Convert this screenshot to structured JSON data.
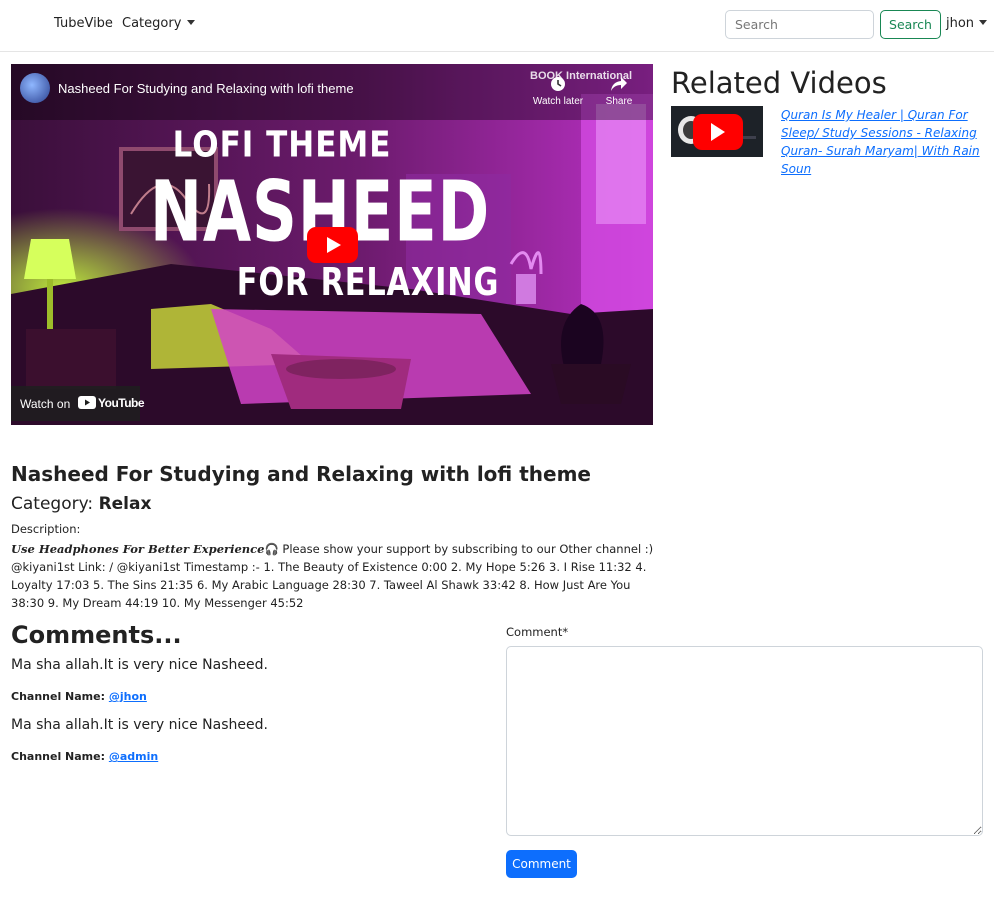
{
  "navbar": {
    "brand": "TubeVibe",
    "category_label": "Category",
    "search_placeholder": "Search",
    "search_button": "Search",
    "user": "jhon"
  },
  "video": {
    "embed_title": "Nasheed For Studying and Relaxing with lofi theme",
    "channel_watermark": "BOOK International",
    "watch_later": "Watch later",
    "share": "Share",
    "thumbnail_line1": "LOFI THEME",
    "thumbnail_line2": "NASHEED",
    "thumbnail_line3": "FOR RELAXING",
    "watch_on": "Watch on",
    "youtube": "YouTube",
    "title": "Nasheed For Studying and Relaxing with lofi theme",
    "category_prefix": "Category:",
    "category": "Relax",
    "description_label": "Description:",
    "description_emphasis": "Use Headphones For Better Experience",
    "description_body": "🎧 Please show your support by subscribing to our Other channel :) @kiyani1st Link: / @kiyani1st Timestamp :- 1. The Beauty of Existence 0:00 2. My Hope 5:26 3. I Rise 11:32 4. Loyalty 17:03 5. The Sins 21:35 6. My Arabic Language 28:30 7. Taweel Al Shawk 33:42 8. How Just Are You 38:30 9. My Dream 44:19 10. My Messenger 45:52"
  },
  "related": {
    "title": "Related Videos",
    "items": [
      {
        "title": "Quran Is My Healer | Quran For Sleep/ Study Sessions - Relaxing Quran- Surah Maryam| With Rain Soun"
      }
    ]
  },
  "comments": {
    "title": "Comments...",
    "channel_label": "Channel Name:",
    "items": [
      {
        "text": "Ma sha allah.It is very nice Nasheed.",
        "channel": "@jhon"
      },
      {
        "text": "Ma sha allah.It is very nice Nasheed.",
        "channel": "@admin"
      }
    ],
    "form_label": "Comment*",
    "submit": "Comment"
  },
  "colors": {
    "primary": "#0d6efd",
    "success": "#198754",
    "youtube_red": "#ff0000"
  }
}
